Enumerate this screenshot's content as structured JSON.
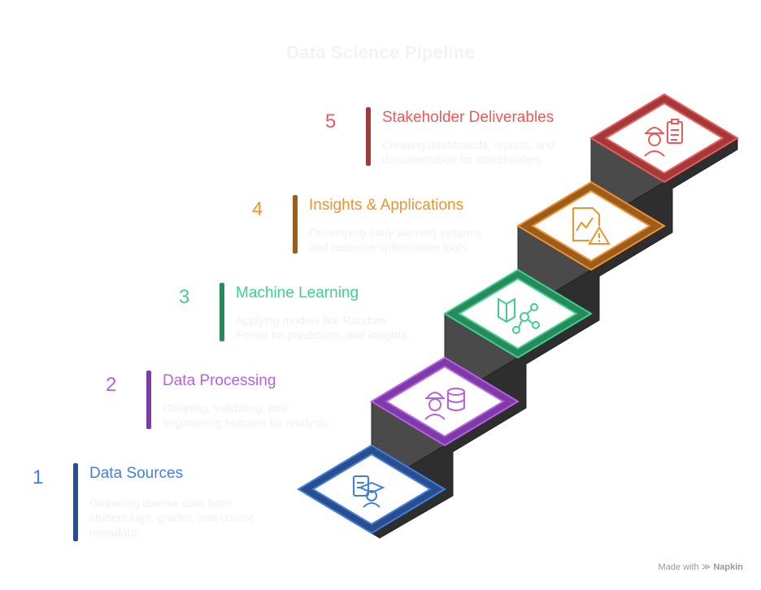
{
  "title": "Data Science Pipeline",
  "steps": [
    {
      "number": "1",
      "title": "Data Sources",
      "description": "Gathering diverse data from\nstudent logs, grades, and course\nmetadata.",
      "color": "#3f7fe0",
      "bar_color": "#2a4d8e",
      "icon": "document-graduation-cap-icon"
    },
    {
      "number": "2",
      "title": "Data Processing",
      "description": "Cleaning, validating, and\nengineering features for analysis.",
      "color": "#b760e6",
      "bar_color": "#7e3aa6",
      "icon": "engineer-database-icon"
    },
    {
      "number": "3",
      "title": "Machine Learning",
      "description": "Applying models like Random\nForest for predictions and insights.",
      "color": "#3fcf8e",
      "bar_color": "#268a5c",
      "icon": "book-network-icon"
    },
    {
      "number": "4",
      "title": "Insights & Applications",
      "description": "Developing early warning systems\nand resource optimization tools.",
      "color": "#f0922e",
      "bar_color": "#9c5d1c",
      "icon": "chart-warning-icon"
    },
    {
      "number": "5",
      "title": "Stakeholder Deliverables",
      "description": "Creating dashboards, reports, and\ndocumentation for stakeholders.",
      "color": "#ee5a5a",
      "bar_color": "#a33a3a",
      "icon": "engineer-clipboard-icon"
    }
  ],
  "credit": {
    "prefix": "Made with",
    "brand": "Napkin"
  }
}
